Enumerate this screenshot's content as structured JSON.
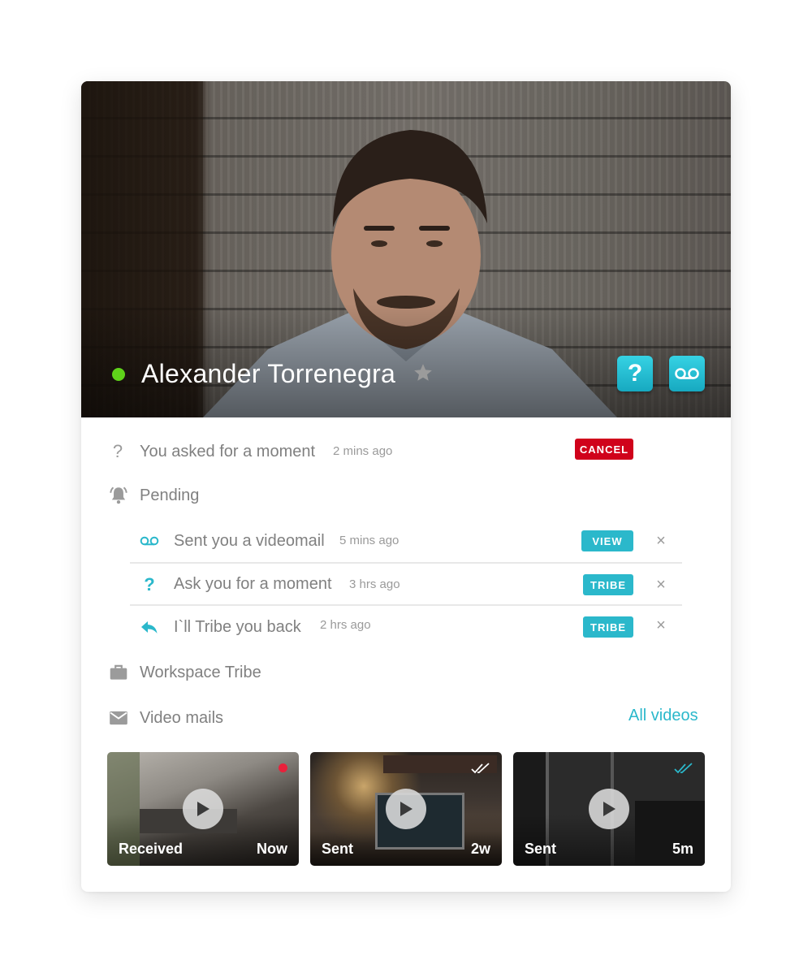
{
  "contact": {
    "name": "Alexander Torrenegra",
    "status": "online",
    "favorite_icon": "star-icon",
    "actions": [
      {
        "name": "ask-for-moment",
        "glyph": "?",
        "icon": "question-icon"
      },
      {
        "name": "videomail",
        "icon": "voicemail-icon"
      }
    ]
  },
  "moment_request": {
    "label": "You asked for a moment",
    "time": "2 mins ago",
    "action": "CANCEL",
    "icon": "question-icon"
  },
  "pending": {
    "label": "Pending",
    "icon": "bell-icon",
    "items": [
      {
        "icon": "voicemail-icon",
        "label": "Sent you a videomail",
        "time": "5 mins ago",
        "action": "VIEW"
      },
      {
        "icon": "question-icon",
        "glyph": "?",
        "label": "Ask you for a moment",
        "time": "3 hrs ago",
        "action": "TRIBE"
      },
      {
        "icon": "reply-icon",
        "label": "I`ll Tribe you back",
        "time": "2 hrs ago",
        "action": "TRIBE"
      }
    ],
    "dismiss_glyph": "×"
  },
  "workspace": {
    "label": "Workspace Tribe",
    "icon": "briefcase-icon"
  },
  "video_mails": {
    "label": "Video mails",
    "icon": "mail-icon",
    "link": "All videos",
    "items": [
      {
        "direction": "Received",
        "age": "Now",
        "indicator": "unseen-dot"
      },
      {
        "direction": "Sent",
        "age": "2w",
        "indicator": "seen-checkmarks"
      },
      {
        "direction": "Sent",
        "age": "5m",
        "indicator": "seen-checkmarks"
      }
    ]
  },
  "colors": {
    "accent": "#2bb8cb",
    "danger": "#d0021b",
    "online": "#5fd31a",
    "text_muted": "#808080"
  }
}
